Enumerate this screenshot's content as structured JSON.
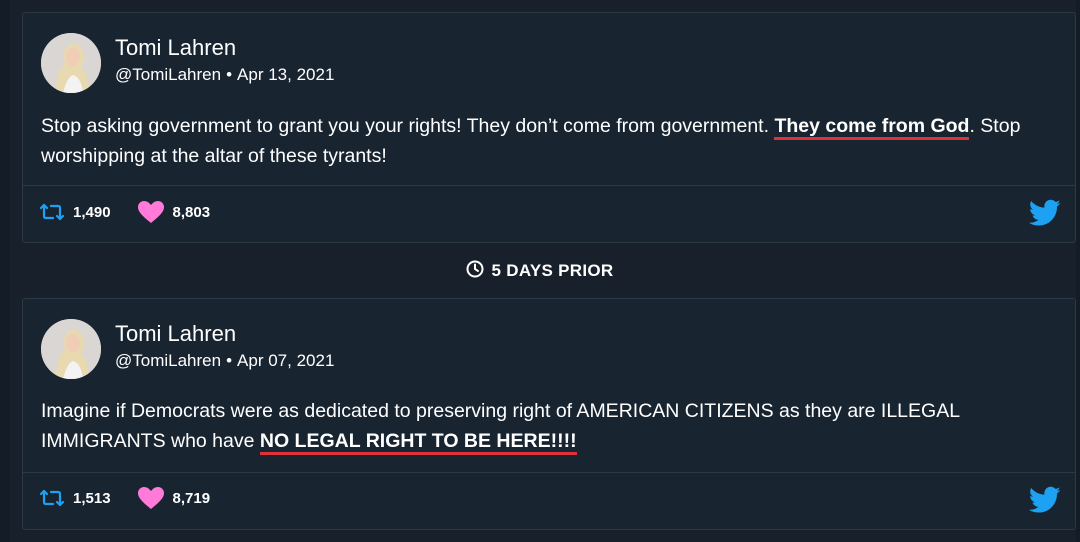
{
  "colors": {
    "background": "#141d27",
    "card": "#192431",
    "border": "#2c3846",
    "text": "#ffffff",
    "highlight_underline": "#e0303a",
    "retweet": "#1da1f2",
    "heart": "#ff7ad9",
    "twitter_bird": "#1da1f2"
  },
  "tweets": [
    {
      "name": "Tomi Lahren",
      "handle": "@TomiLahren",
      "separator": "•",
      "date": "Apr 13, 2021",
      "text_before": "Stop asking government to grant you your rights! They don’t come from government. ",
      "text_highlight": "They come from God",
      "text_after": ". Stop worshipping at the altar of these tyrants!",
      "retweets": "1,490",
      "likes": "8,803",
      "icons": [
        "avatar",
        "retweet-icon",
        "heart-icon",
        "twitter-bird-icon"
      ]
    },
    {
      "name": "Tomi Lahren",
      "handle": "@TomiLahren",
      "separator": "•",
      "date": "Apr 07, 2021",
      "text_before": "Imagine if Democrats were as dedicated to preserving right of AMERICAN CITIZENS as they are ILLEGAL IMMIGRANTS who have ",
      "text_highlight": "NO LEGAL RIGHT TO BE HERE!!!!",
      "text_after": "",
      "retweets": "1,513",
      "likes": "8,719",
      "icons": [
        "avatar",
        "retweet-icon",
        "heart-icon",
        "twitter-bird-icon"
      ]
    }
  ],
  "separator_label": "5 DAYS PRIOR",
  "separator_icon": "clock-icon"
}
